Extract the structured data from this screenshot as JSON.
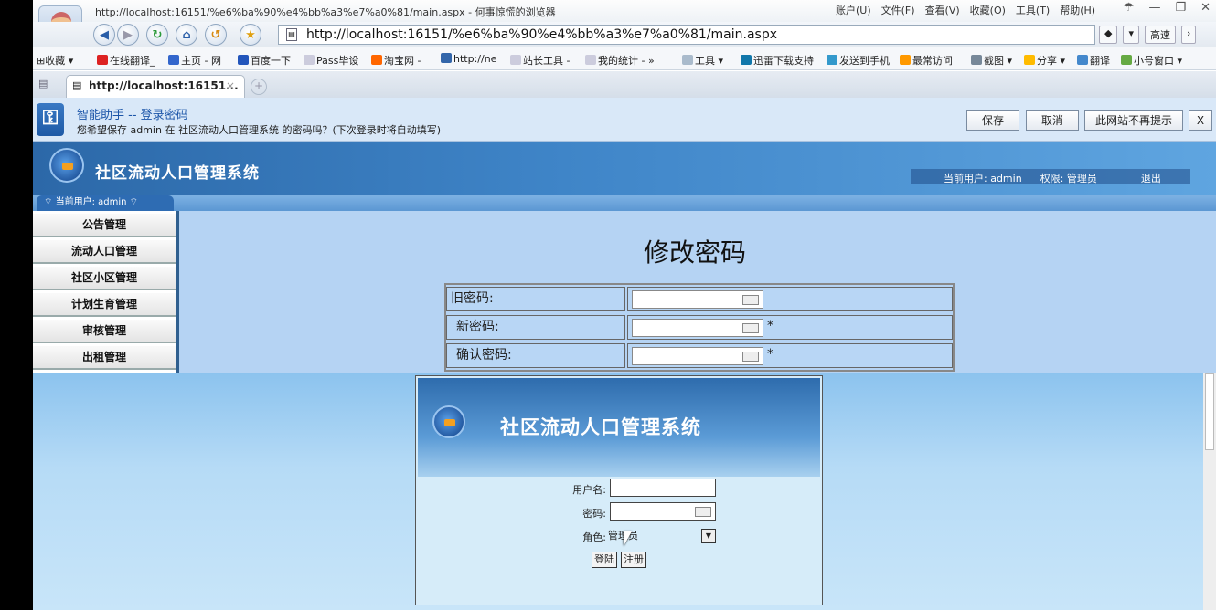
{
  "browser": {
    "window_title": "http://localhost:16151/%e6%ba%90%e4%bb%a3%e7%a0%81/main.aspx - 何事惊慌的浏览器",
    "menus": [
      "账户(U)",
      "文件(F)",
      "查看(V)",
      "收藏(O)",
      "工具(T)",
      "帮助(H)"
    ],
    "address": "http://localhost:16151/%e6%ba%90%e4%bb%a3%e7%a0%81/main.aspx",
    "speed_label": "高速",
    "favorites": [
      "收藏",
      "在线翻译_",
      "主页 - 网",
      "百度一下",
      "Pass毕设",
      "淘宝网 -",
      "http://ne",
      "站长工具 -",
      "我的统计 -",
      "工具",
      "迅雷下载支持",
      "发送到手机",
      "最常访问",
      "截图",
      "分享",
      "翻译",
      "小号窗口"
    ],
    "tab_title": "http://localhost:16151...",
    "tab_close": "×"
  },
  "helper": {
    "title": "智能助手 -- 登录密码",
    "message": "您希望保存 admin 在 社区流动人口管理系统 的密码吗？(下次登录时将自动填写)",
    "save": "保存",
    "cancel": "取消",
    "never": "此网站不再提示",
    "close": "X"
  },
  "app": {
    "name": "社区流动人口管理系统",
    "current_user": "当前用户: admin",
    "role": "权限: 管理员",
    "logout": "退出",
    "strip_user": "当前用户: admin"
  },
  "sidebar": {
    "items": [
      "公告管理",
      "流动人口管理",
      "社区小区管理",
      "计划生育管理",
      "审核管理",
      "出租管理"
    ]
  },
  "change_password": {
    "title": "修改密码",
    "old_label": "旧密码:",
    "new_label": "新密码:",
    "confirm_label": "确认密码:",
    "required_mark": "*"
  },
  "login": {
    "system_name": "社区流动人口管理系统",
    "username_label": "用户名:",
    "password_label": "密码:",
    "role_label": "角色:",
    "role_value": "管理员",
    "login_button": "登陆",
    "register_button": "注册"
  }
}
